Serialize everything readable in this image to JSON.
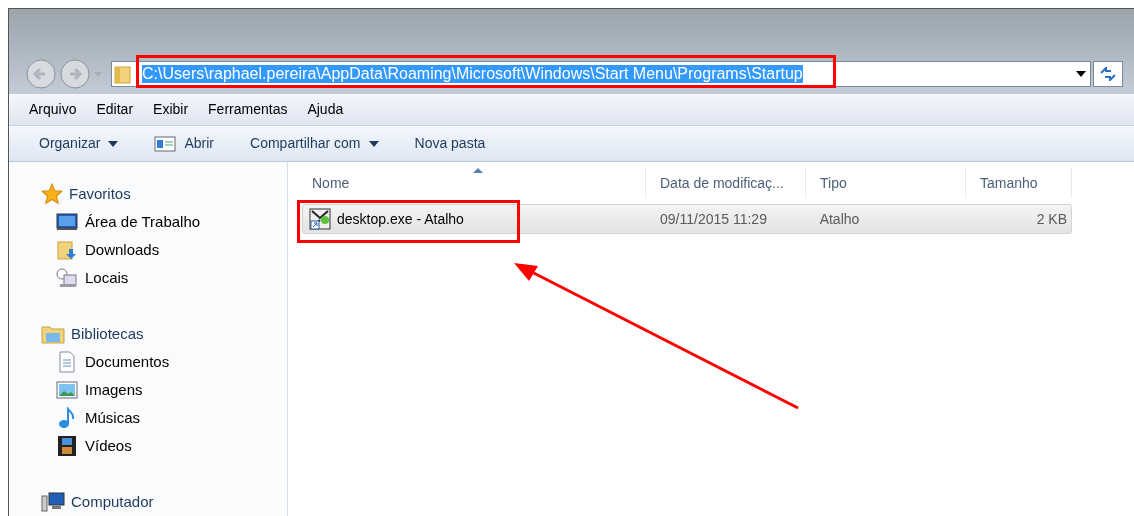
{
  "address_bar": {
    "path": "C:\\Users\\raphael.pereira\\AppData\\Roaming\\Microsoft\\Windows\\Start Menu\\Programs\\Startup",
    "selected": true
  },
  "menu": [
    "Arquivo",
    "Editar",
    "Exibir",
    "Ferramentas",
    "Ajuda"
  ],
  "toolbar": [
    {
      "label": "Organizar",
      "kind": "dropdown"
    },
    {
      "label": "Abrir",
      "kind": "icon"
    },
    {
      "label": "Compartilhar com",
      "kind": "dropdown"
    },
    {
      "label": "Nova pasta",
      "kind": "plain"
    }
  ],
  "sidebar": {
    "groups": [
      {
        "label": "Favoritos",
        "children": [
          {
            "label": "Área de Trabalho"
          },
          {
            "label": "Downloads"
          },
          {
            "label": "Locais"
          }
        ]
      },
      {
        "label": "Bibliotecas",
        "children": [
          {
            "label": "Documentos"
          },
          {
            "label": "Imagens"
          },
          {
            "label": "Músicas"
          },
          {
            "label": "Vídeos"
          }
        ]
      },
      {
        "label": "Computador"
      }
    ]
  },
  "table": {
    "columns": [
      "Nome",
      "Data de modificaç...",
      "Tipo",
      "Tamanho"
    ],
    "rows": [
      {
        "cells": [
          "desktop.exe - Atalho",
          "09/11/2015 11:29",
          "Atalho",
          "2 KB"
        ],
        "selected": true
      }
    ]
  },
  "annotations": [
    {
      "kind": "address-box"
    },
    {
      "kind": "row-box"
    },
    {
      "kind": "arrow"
    }
  ]
}
